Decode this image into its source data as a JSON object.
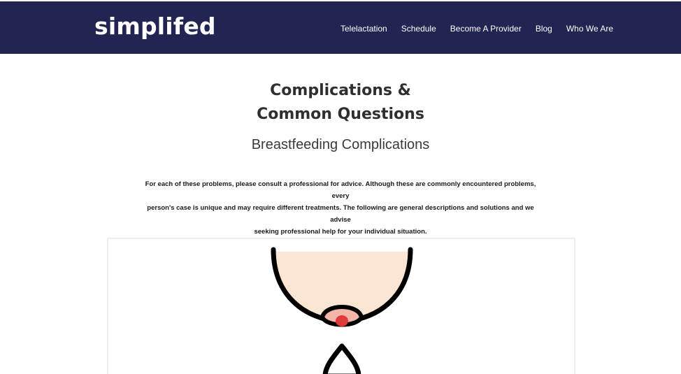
{
  "site": {
    "logo": "simplifed"
  },
  "nav": {
    "items": [
      {
        "label": "Telelactation"
      },
      {
        "label": "Schedule"
      },
      {
        "label": "Become A Provider"
      },
      {
        "label": "Blog"
      },
      {
        "label": "Who We Are"
      }
    ]
  },
  "main": {
    "title_line1": "Complications &",
    "title_line2": "Common Questions",
    "subtitle": "Breastfeeding Complications",
    "intro_line1": "For each of these problems, please consult a professional for advice.  Although these are commonly encountered problems, every",
    "intro_line2": "person's case is unique and may require different treatments.  The following are general descriptions and solutions and we advise",
    "intro_line3": "seeking professional help for your individual situation."
  },
  "colors": {
    "navbar_bg": "#222452",
    "skin": "#FBE6D3",
    "areola": "#F2B5A8",
    "nipple": "#E03A3A",
    "outline": "#000000"
  },
  "illustration": {
    "icons": [
      "breast-illustration-icon",
      "droplet-icon"
    ]
  }
}
